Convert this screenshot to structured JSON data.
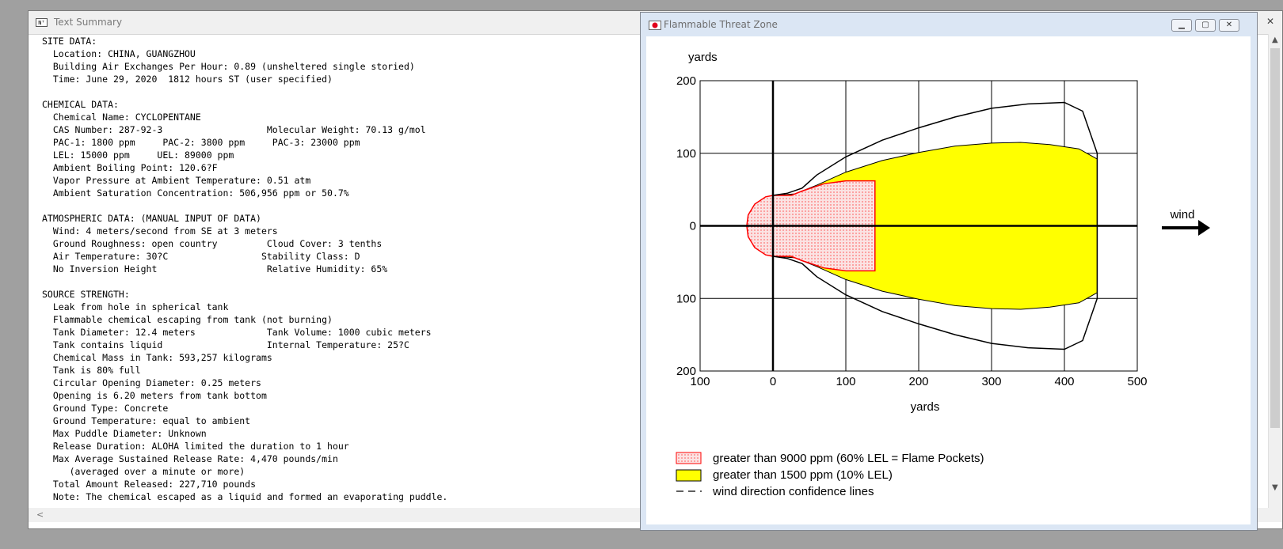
{
  "text_summary": {
    "title": "Text Summary",
    "lines": [
      "SITE DATA:",
      "  Location: CHINA, GUANGZHOU",
      "  Building Air Exchanges Per Hour: 0.89 (unsheltered single storied)",
      "  Time: June 29, 2020  1812 hours ST (user specified)",
      "",
      "CHEMICAL DATA:",
      "  Chemical Name: CYCLOPENTANE",
      "  CAS Number: 287-92-3                   Molecular Weight: 70.13 g/mol",
      "  PAC-1: 1800 ppm     PAC-2: 3800 ppm     PAC-3: 23000 ppm",
      "  LEL: 15000 ppm     UEL: 89000 ppm",
      "  Ambient Boiling Point: 120.6?F",
      "  Vapor Pressure at Ambient Temperature: 0.51 atm",
      "  Ambient Saturation Concentration: 506,956 ppm or 50.7%",
      "",
      "ATMOSPHERIC DATA: (MANUAL INPUT OF DATA)",
      "  Wind: 4 meters/second from SE at 3 meters",
      "  Ground Roughness: open country         Cloud Cover: 3 tenths",
      "  Air Temperature: 30?C                 Stability Class: D",
      "  No Inversion Height                    Relative Humidity: 65%",
      "",
      "SOURCE STRENGTH:",
      "  Leak from hole in spherical tank",
      "  Flammable chemical escaping from tank (not burning)",
      "  Tank Diameter: 12.4 meters             Tank Volume: 1000 cubic meters",
      "  Tank contains liquid                   Internal Temperature: 25?C",
      "  Chemical Mass in Tank: 593,257 kilograms",
      "  Tank is 80% full",
      "  Circular Opening Diameter: 0.25 meters",
      "  Opening is 6.20 meters from tank bottom",
      "  Ground Type: Concrete",
      "  Ground Temperature: equal to ambient",
      "  Max Puddle Diameter: Unknown",
      "  Release Duration: ALOHA limited the duration to 1 hour",
      "  Max Average Sustained Release Rate: 4,470 pounds/min",
      "     (averaged over a minute or more)",
      "  Total Amount Released: 227,710 pounds",
      "  Note: The chemical escaped as a liquid and formed an evaporating puddle."
    ]
  },
  "threat_zone": {
    "title": "Flammable Threat Zone",
    "wind_label": "wind",
    "legend": [
      {
        "label": "greater than 9000 ppm (60% LEL = Flame Pockets)",
        "fill": "#fbe3e3",
        "stroke": "#ff0000"
      },
      {
        "label": "greater than 1500 ppm (10% LEL)",
        "fill": "#ffff00",
        "stroke": "#000000"
      },
      {
        "label": "wind direction confidence lines",
        "fill": "none",
        "stroke": "#000000"
      }
    ]
  },
  "chart_data": {
    "type": "area",
    "xlabel": "yards",
    "ylabel": "yards",
    "xlim": [
      -100,
      500
    ],
    "ylim": [
      -200,
      200
    ],
    "xticks": [
      -100,
      0,
      100,
      200,
      300,
      400,
      500
    ],
    "yticks": [
      -200,
      -100,
      0,
      100,
      200
    ],
    "x_tick_labels": [
      "100",
      "0",
      "100",
      "200",
      "300",
      "400",
      "500"
    ],
    "y_tick_labels": [
      "200",
      "100",
      "0",
      "100",
      "200"
    ],
    "grid": true,
    "legend_position": "bottom",
    "series": [
      {
        "name": "greater than 1500 ppm (10% LEL)",
        "color": "#ffff00",
        "points": [
          [
            0,
            42
          ],
          [
            30,
            44
          ],
          [
            60,
            56
          ],
          [
            100,
            74
          ],
          [
            150,
            90
          ],
          [
            200,
            101
          ],
          [
            250,
            110
          ],
          [
            300,
            114
          ],
          [
            340,
            115
          ],
          [
            380,
            112
          ],
          [
            420,
            106
          ],
          [
            445,
            92
          ],
          [
            445,
            -92
          ],
          [
            420,
            -106
          ],
          [
            380,
            -112
          ],
          [
            340,
            -115
          ],
          [
            300,
            -114
          ],
          [
            250,
            -110
          ],
          [
            200,
            -101
          ],
          [
            150,
            -90
          ],
          [
            100,
            -74
          ],
          [
            60,
            -56
          ],
          [
            30,
            -44
          ],
          [
            0,
            -42
          ]
        ]
      },
      {
        "name": "greater than 9000 ppm (60% LEL = Flame Pockets)",
        "color": "#ff0000",
        "points": [
          [
            0,
            42
          ],
          [
            -10,
            40
          ],
          [
            -25,
            30
          ],
          [
            -34,
            15
          ],
          [
            -36,
            0
          ],
          [
            -34,
            -15
          ],
          [
            -25,
            -30
          ],
          [
            -10,
            -40
          ],
          [
            0,
            -42
          ],
          [
            25,
            -42
          ],
          [
            40,
            -48
          ],
          [
            70,
            -58
          ],
          [
            100,
            -62
          ],
          [
            140,
            -62
          ],
          [
            140,
            62
          ],
          [
            100,
            62
          ],
          [
            70,
            58
          ],
          [
            40,
            48
          ],
          [
            25,
            42
          ]
        ]
      },
      {
        "name": "wind direction confidence lines",
        "color": "#000000",
        "points": [
          [
            0,
            42
          ],
          [
            20,
            45
          ],
          [
            40,
            52
          ],
          [
            60,
            70
          ],
          [
            100,
            95
          ],
          [
            150,
            118
          ],
          [
            200,
            135
          ],
          [
            250,
            150
          ],
          [
            300,
            162
          ],
          [
            350,
            168
          ],
          [
            400,
            170
          ],
          [
            425,
            158
          ],
          [
            445,
            100
          ],
          [
            445,
            -100
          ],
          [
            425,
            -158
          ],
          [
            400,
            -170
          ],
          [
            350,
            -168
          ],
          [
            300,
            -162
          ],
          [
            250,
            -150
          ],
          [
            200,
            -135
          ],
          [
            150,
            -118
          ],
          [
            100,
            -95
          ],
          [
            60,
            -70
          ],
          [
            40,
            -52
          ],
          [
            20,
            -45
          ],
          [
            0,
            -42
          ]
        ]
      }
    ]
  }
}
